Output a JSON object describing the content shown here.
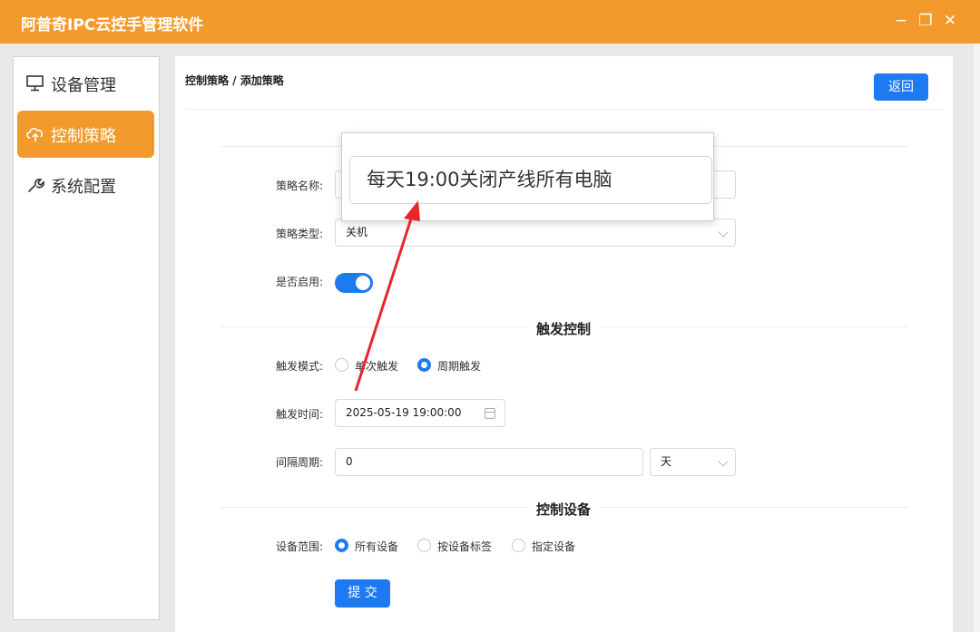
{
  "app": {
    "title": "阿普奇IPC云控手管理软件"
  },
  "window_controls": {
    "minimize": "−",
    "restore": "❐",
    "close": "✕"
  },
  "sidebar": {
    "items": [
      {
        "label": "设备管理",
        "icon": "monitor-icon",
        "active": false
      },
      {
        "label": "控制策略",
        "icon": "cloud-upload-icon",
        "active": true
      },
      {
        "label": "系统配置",
        "icon": "wrench-icon",
        "active": false
      }
    ]
  },
  "header": {
    "breadcrumb": "控制策略 / 添加策略",
    "back_label": "返回"
  },
  "form": {
    "name_label": "策略名称:",
    "name_value": "每天19:00关闭产线所有电脑",
    "type_label": "策略类型:",
    "type_value": "关机",
    "enable_label": "是否启用:",
    "enabled": true
  },
  "trigger": {
    "section_title": "触发控制",
    "mode_label": "触发模式:",
    "mode_options": [
      "单次触发",
      "周期触发"
    ],
    "mode_selected": "周期触发",
    "time_label": "触发时间:",
    "time_value": "2025-05-19 19:00:00",
    "interval_label": "间隔周期:",
    "interval_value": "0",
    "interval_unit": "天"
  },
  "devices": {
    "section_title": "控制设备",
    "scope_label": "设备范围:",
    "scope_options": [
      "所有设备",
      "按设备标签",
      "指定设备"
    ],
    "scope_selected": "所有设备"
  },
  "submit_label": "提 交",
  "colors": {
    "accent_orange": "#f39a2c",
    "primary_blue": "#1e7af0",
    "arrow_red": "#e8252a"
  }
}
